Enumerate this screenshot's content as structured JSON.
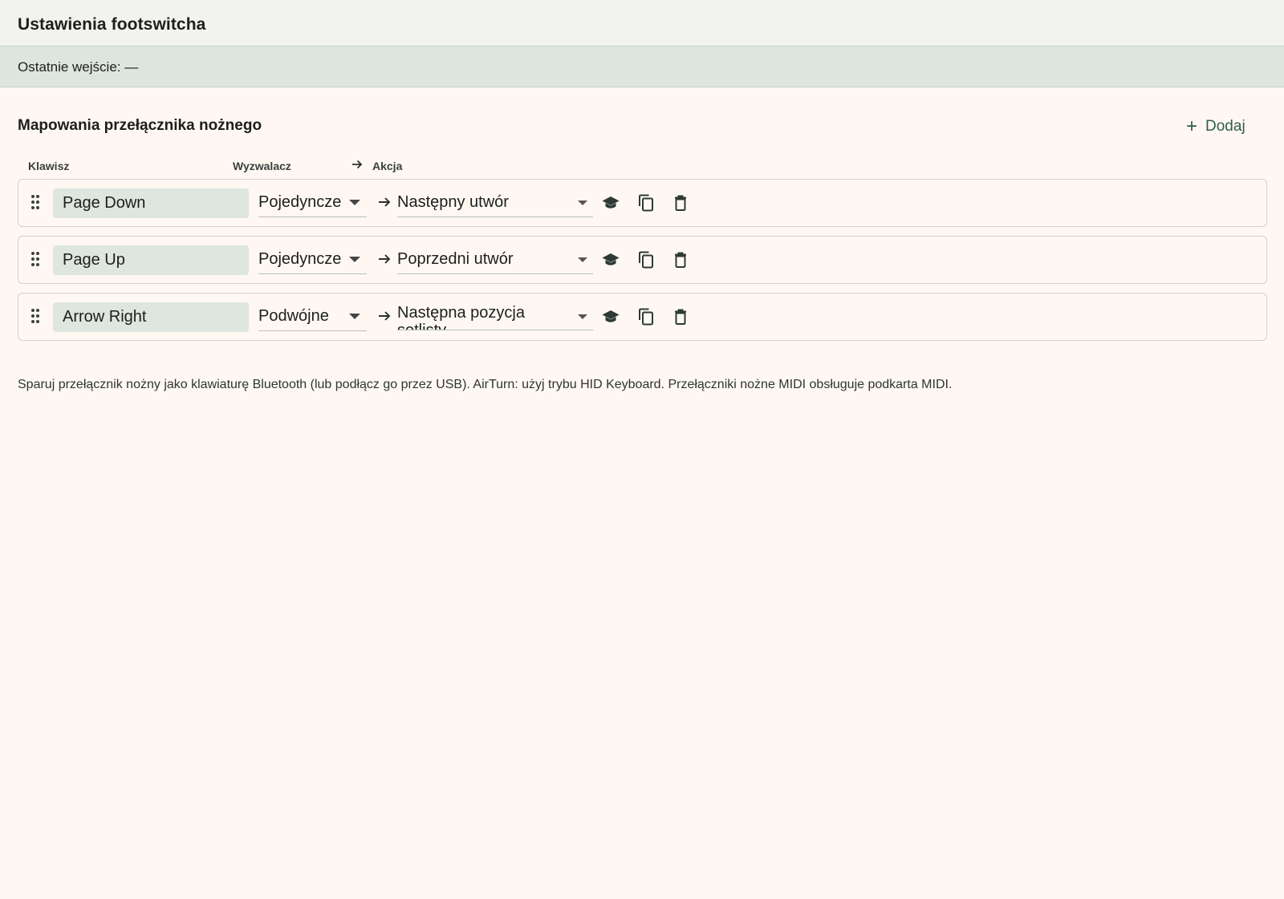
{
  "header": {
    "title": "Ustawienia footswitcha"
  },
  "status": {
    "last_input": "Ostatnie wejście: —"
  },
  "section": {
    "title": "Mapowania przełącznika nożnego",
    "add_label": "Dodaj",
    "add_icon": "plus-icon"
  },
  "columns": {
    "key": "Klawisz",
    "trigger": "Wyzwalacz",
    "action": "Akcja"
  },
  "mappings": [
    {
      "key": "Page Down",
      "trigger": "Pojedyncze",
      "action": "Następny utwór"
    },
    {
      "key": "Page Up",
      "trigger": "Pojedyncze",
      "action": "Poprzedni utwór"
    },
    {
      "key": "Arrow Right",
      "trigger": "Podwójne",
      "action": "Następna pozycja setlisty"
    }
  ],
  "icons": {
    "drag": "drag-handle-icon",
    "arrow": "arrow-right-icon",
    "learn": "learn-icon",
    "copy": "copy-icon",
    "delete": "delete-icon"
  },
  "colors": {
    "accent": "#2e5f4a",
    "status_bg": "#dee5df",
    "field_bg": "#dfe5df",
    "page_bg": "#fff8f2"
  },
  "help": "Sparuj przełącznik nożny jako klawiaturę Bluetooth (lub podłącz go przez USB). AirTurn: użyj trybu HID Keyboard. Przełączniki nożne MIDI obsługuje podkarta MIDI."
}
